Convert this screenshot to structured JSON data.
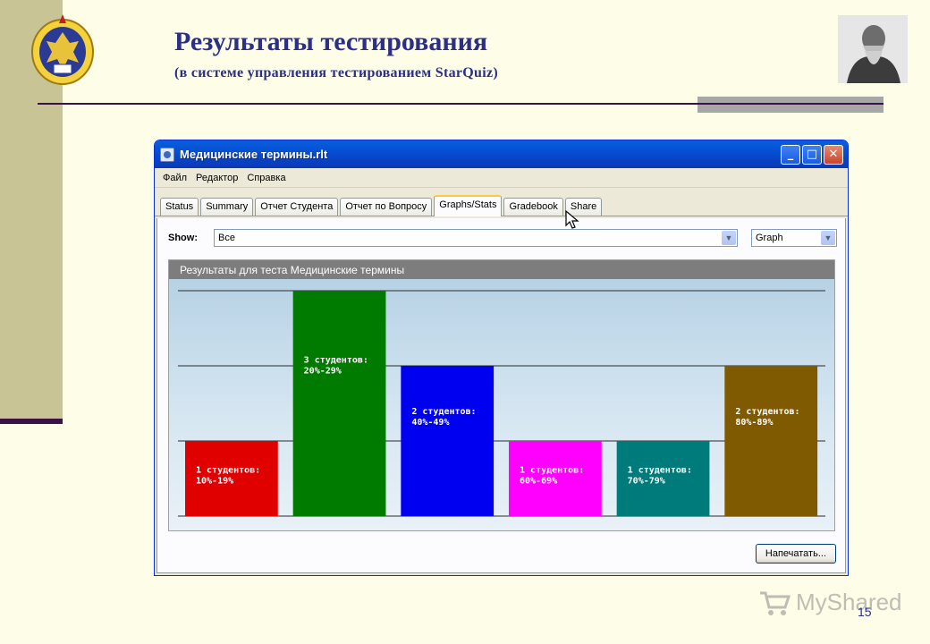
{
  "slide": {
    "title": "Результаты тестирования",
    "subtitle": "(в системе управления тестированием StarQuiz)",
    "page_number": "15",
    "watermark": "MyShared",
    "colors": {
      "title": "#2c2f86",
      "band": "#c8c495",
      "rule": "#3b1146"
    }
  },
  "window": {
    "title": "Медицинские термины.rlt",
    "controls": {
      "minimize": "_",
      "maximize": "□",
      "close": "✕"
    },
    "menu": [
      "Файл",
      "Редактор",
      "Справка"
    ],
    "tabs": [
      {
        "label": "Status",
        "active": false
      },
      {
        "label": "Summary",
        "active": false
      },
      {
        "label": "Отчет Студента",
        "active": false
      },
      {
        "label": "Отчет по Вопросу",
        "active": false
      },
      {
        "label": "Graphs/Stats",
        "active": true
      },
      {
        "label": "Gradebook",
        "active": false
      },
      {
        "label": "Share",
        "active": false
      }
    ],
    "show_label": "Show:",
    "show_value": "Все",
    "view_value": "Graph",
    "chart_header": "Результаты для теста Медицинские термины",
    "print_button": "Напечатать..."
  },
  "chart_data": {
    "type": "bar",
    "title": "Результаты для теста Медицинские термины",
    "categories": [
      "10%-19%",
      "20%-29%",
      "40%-49%",
      "60%-69%",
      "70%-79%",
      "80%-89%"
    ],
    "values": [
      1,
      3,
      2,
      1,
      1,
      2
    ],
    "labels": [
      [
        "1 студентов:",
        "10%-19%"
      ],
      [
        "3 студентов:",
        "20%-29%"
      ],
      [
        "2 студентов:",
        "40%-49%"
      ],
      [
        "1 студентов:",
        "60%-69%"
      ],
      [
        "1 студентов:",
        "70%-79%"
      ],
      [
        "2 студентов:",
        "80%-89%"
      ]
    ],
    "colors": [
      "#e00000",
      "#007b00",
      "#0000f0",
      "#ff00ff",
      "#007b7b",
      "#805a00"
    ],
    "ylim": [
      0,
      3
    ],
    "grid": true,
    "xlabel": "",
    "ylabel": ""
  }
}
